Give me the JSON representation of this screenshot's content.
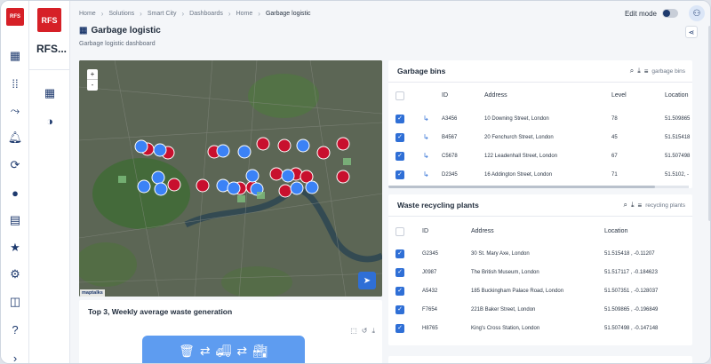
{
  "rail": {
    "logo_text": "RFS",
    "icons": [
      "dashboard-grid-icon",
      "apps-icon",
      "trend-icon",
      "alarm-icon",
      "sync-icon",
      "account-icon",
      "business-icon",
      "folder-star-icon",
      "settings-icon",
      "widgets-icon",
      "help-icon",
      "expand-icon"
    ]
  },
  "sidebar": {
    "logo_text": "RFS",
    "brand_name": "RFS..."
  },
  "breadcrumb": [
    "Home",
    "Solutions",
    "Smart City",
    "Dashboards",
    "Home",
    "Garbage logistic"
  ],
  "header": {
    "edit_mode_label": "Edit mode"
  },
  "page": {
    "title": "Garbage logistic",
    "subtitle": "Garbage logistic dashboard"
  },
  "map": {
    "zoom_in": "+",
    "zoom_out": "-",
    "attribution": "maptalks"
  },
  "weekly_card": {
    "title": "Top 3, Weekly average waste generation"
  },
  "garbage_bins": {
    "title": "Garbage bins",
    "filter_label": "garbage bins",
    "columns": [
      "ID",
      "Address",
      "Level",
      "Location"
    ],
    "rows": [
      {
        "id": "A3456",
        "address": "10 Downing Street, London",
        "level": "78",
        "location": "51.509865"
      },
      {
        "id": "B4567",
        "address": "20 Fenchurch Street, London",
        "level": "45",
        "location": "51.515418"
      },
      {
        "id": "C5678",
        "address": "122 Leadenhall Street, London",
        "level": "67",
        "location": "51.507498"
      },
      {
        "id": "D2345",
        "address": "16 Addington Street, London",
        "level": "71",
        "location": "51.5102, -"
      }
    ]
  },
  "recycling_plants": {
    "title": "Waste recycling plants",
    "filter_label": "recycling plants",
    "columns": [
      "ID",
      "Address",
      "Location"
    ],
    "rows": [
      {
        "id": "G2345",
        "address": "30 St. Mary Axe, London",
        "location": "51.515418 , -0.11207"
      },
      {
        "id": "J0987",
        "address": "The British Museum, London",
        "location": "51.517117 , -0.184623"
      },
      {
        "id": "A5432",
        "address": "185 Buckingham Palace Road, London",
        "location": "51.507351 , -0.128037"
      },
      {
        "id": "F7654",
        "address": "221B Baker Street, London",
        "location": "51.509865 , -0.196849"
      },
      {
        "id": "H8765",
        "address": "King's Cross Station, London",
        "location": "51.507498 , -0.147148"
      }
    ]
  },
  "colors": {
    "accent": "#2f6fd6",
    "brand": "#d62027",
    "bin_marker": "#c8102e",
    "truck_marker": "#3b82f6"
  }
}
